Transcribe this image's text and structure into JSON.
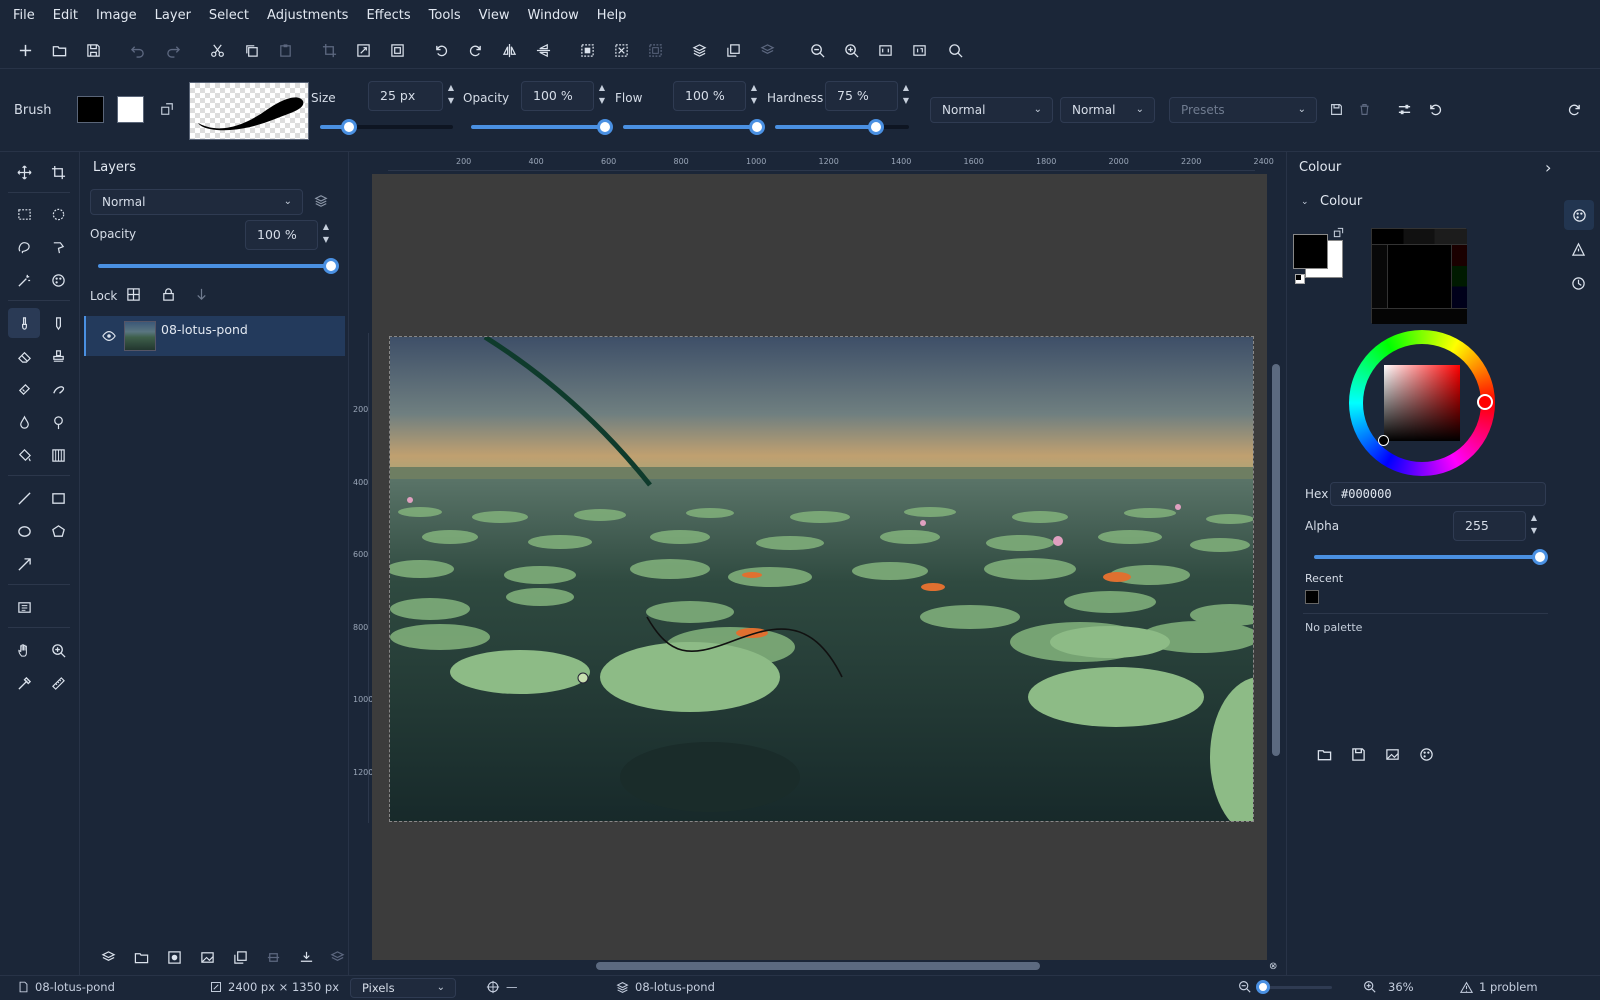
{
  "menu": [
    "File",
    "Edit",
    "Image",
    "Layer",
    "Select",
    "Adjustments",
    "Effects",
    "Tools",
    "View",
    "Window",
    "Help"
  ],
  "options": {
    "tool_label": "Brush",
    "size_label": "Size",
    "size_value": "25 px",
    "size_level": 0.22,
    "opacity_label": "Opacity",
    "opacity_value": "100 %",
    "opacity_level": 1.0,
    "flow_label": "Flow",
    "flow_value": "100 %",
    "flow_level": 1.0,
    "hardness_label": "Hardness",
    "hardness_value": "75 %",
    "hardness_level": 0.75,
    "blend_mode_1": "Normal",
    "blend_mode_2": "Normal",
    "presets_placeholder": "Presets"
  },
  "layers": {
    "title": "Layers",
    "blend_mode": "Normal",
    "opacity_label": "Opacity",
    "opacity_value": "100 %",
    "opacity_level": 1.0,
    "lock_label": "Lock",
    "items": [
      {
        "name": "08-lotus-pond",
        "visible": true
      }
    ]
  },
  "rulers": {
    "h_ticks": [
      "200",
      "400",
      "600",
      "800",
      "1000",
      "1200",
      "1400",
      "1600",
      "1800",
      "2000",
      "2200",
      "2400"
    ],
    "v_ticks": [
      "200",
      "400",
      "600",
      "800",
      "1000",
      "1200"
    ]
  },
  "colour": {
    "panel_title": "Colour",
    "section_title": "Colour",
    "hex_label": "Hex",
    "hex_value": "#000000",
    "alpha_label": "Alpha",
    "alpha_value": "255",
    "alpha_level": 1.0,
    "recent_label": "Recent",
    "palette_text": "No palette",
    "primary": "#000000",
    "secondary": "#ffffff"
  },
  "status": {
    "document": "08-lotus-pond",
    "dimensions": "2400 px × 1350 px",
    "units": "Pixels",
    "cursor": "—",
    "layer": "08-lotus-pond",
    "zoom": "36%",
    "problems": "1 problem"
  },
  "colors": {
    "accent": "#4a90e2",
    "bg": "#1b2638"
  }
}
